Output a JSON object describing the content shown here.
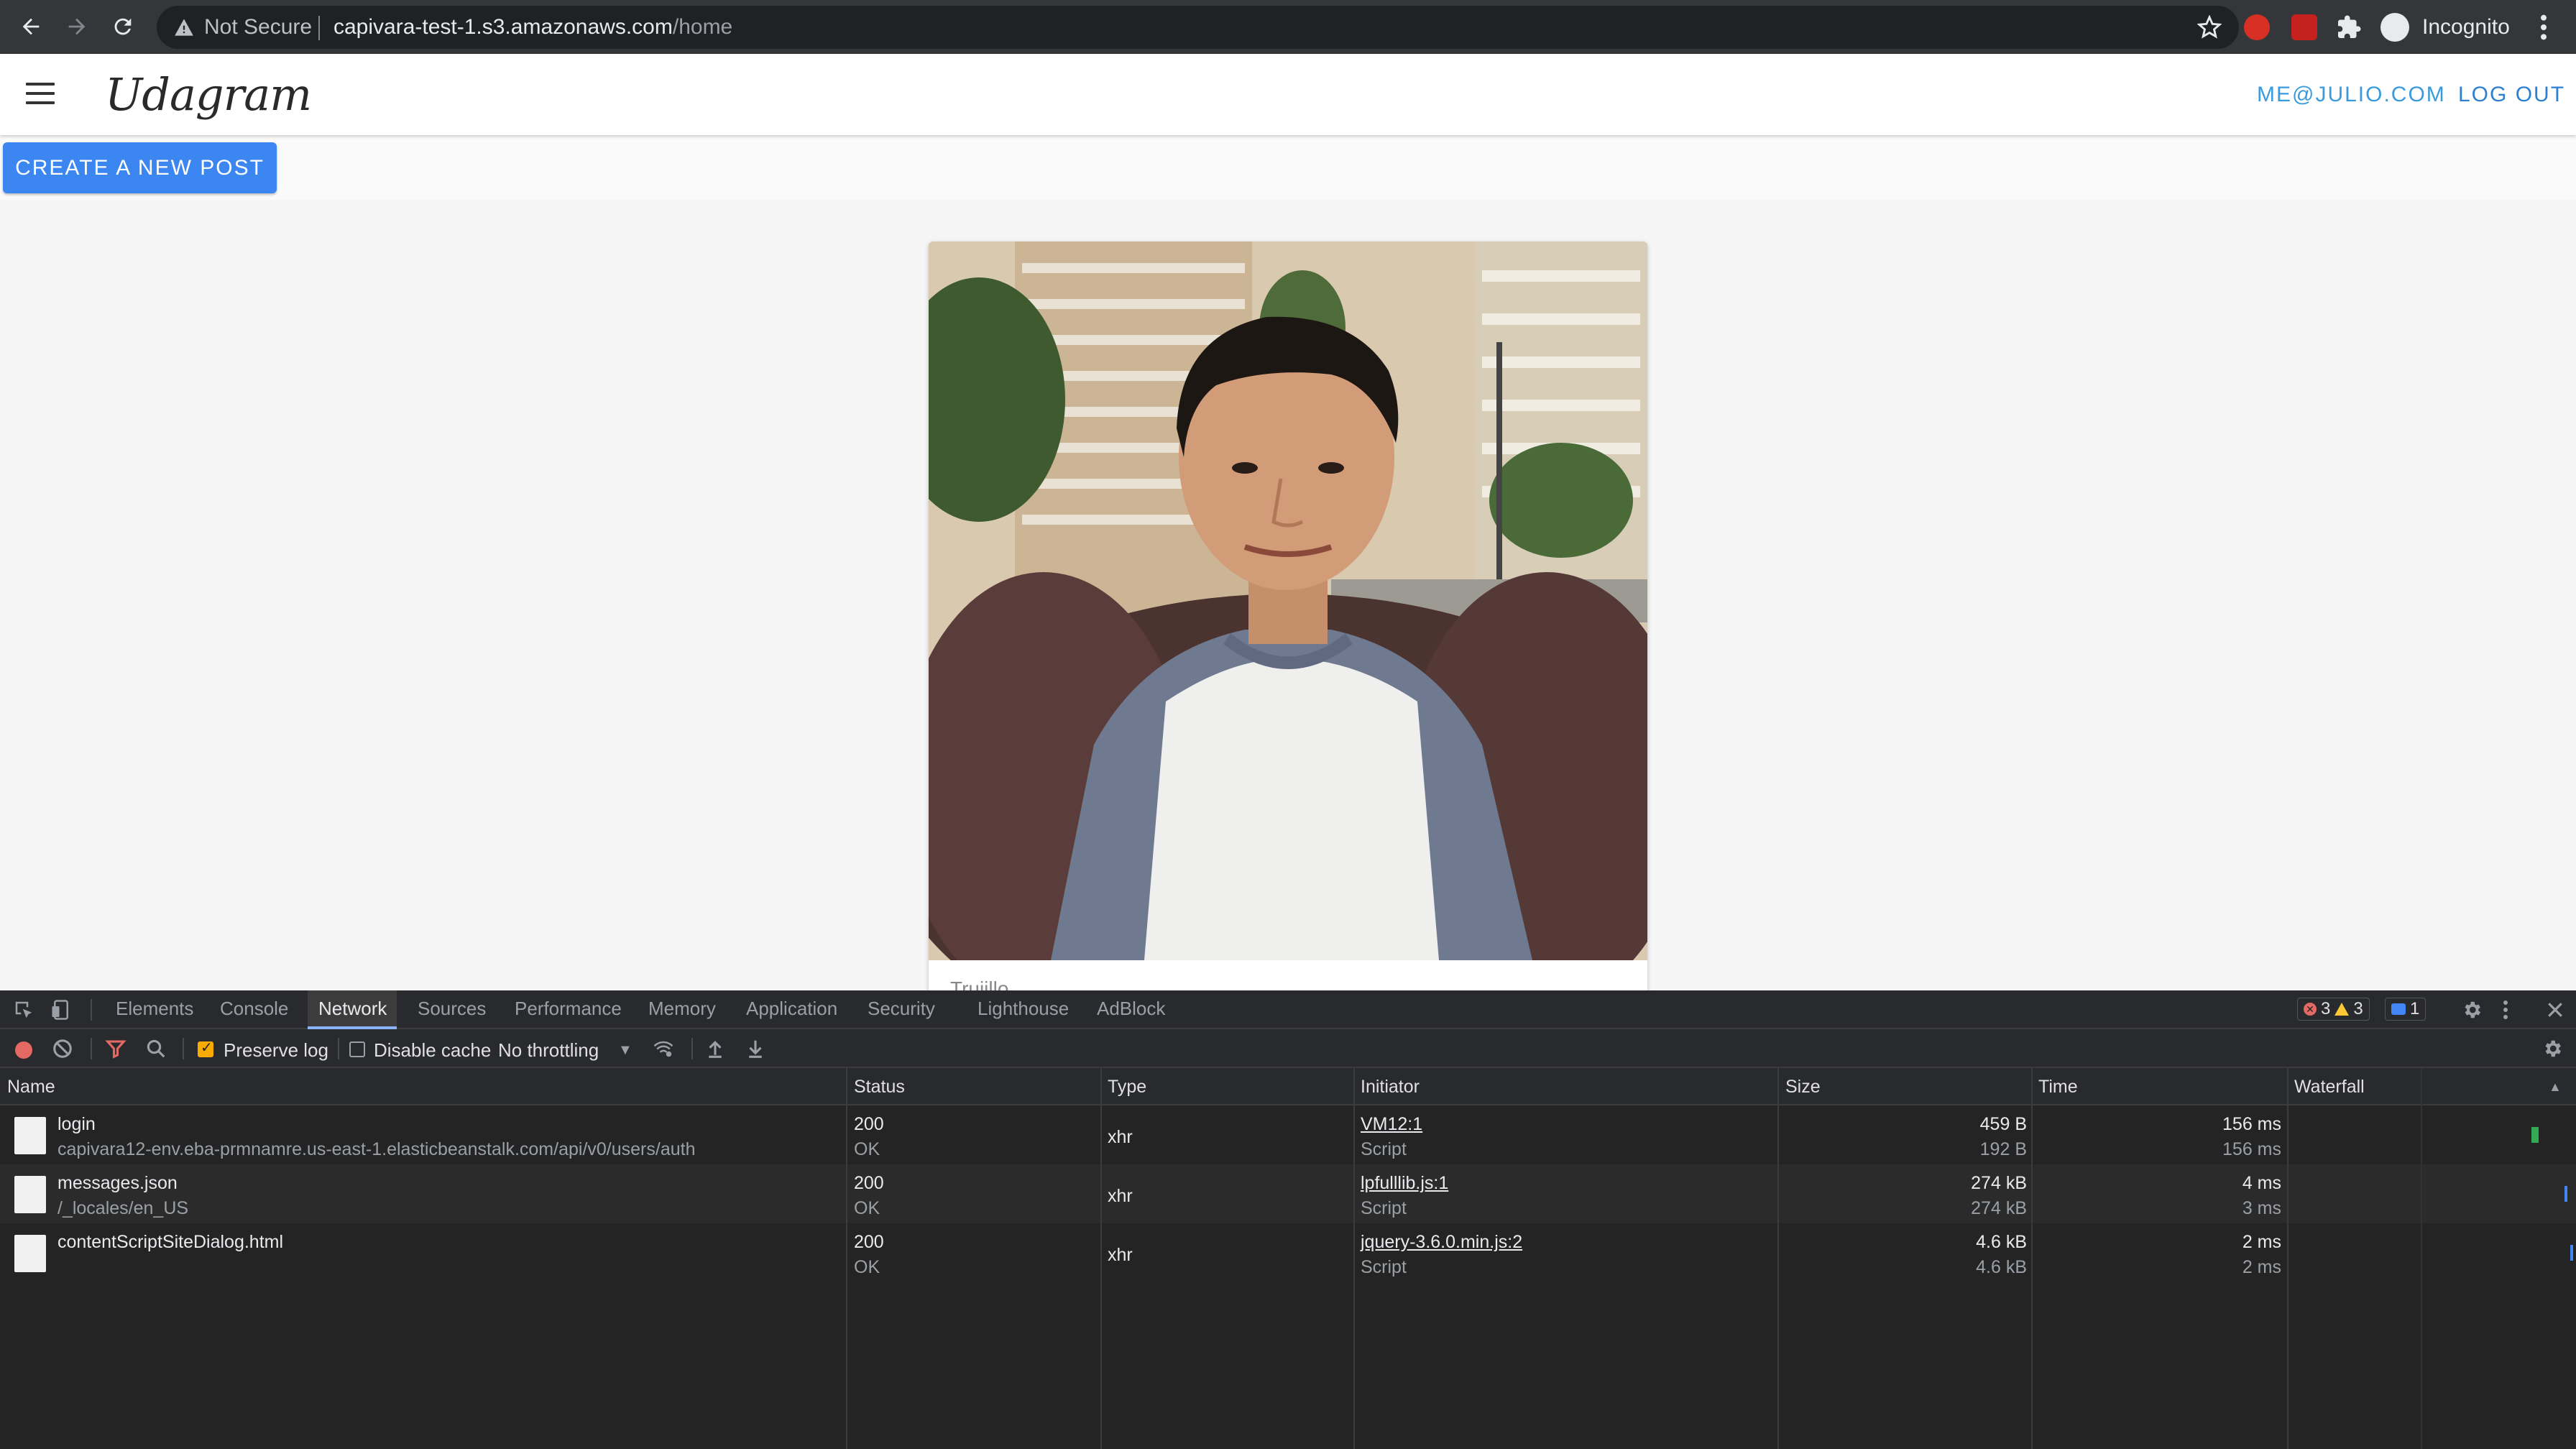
{
  "browser": {
    "security_label": "Not Secure",
    "url_host": "capivara-test-1.s3.amazonaws.com",
    "url_path": "/home",
    "profile_label": "Incognito"
  },
  "app": {
    "brand": "Udagram",
    "user_email": "ME@JULIO.COM",
    "logout_label": "LOG OUT",
    "create_post_label": "CREATE A NEW POST",
    "post": {
      "caption": "Trujillo"
    }
  },
  "devtools": {
    "tabs": [
      "Elements",
      "Console",
      "Network",
      "Sources",
      "Performance",
      "Memory",
      "Application",
      "Security",
      "Lighthouse",
      "AdBlock"
    ],
    "active_tab": "Network",
    "errors_count": "3",
    "warnings_count": "3",
    "messages_count": "1",
    "toolbar": {
      "preserve_log_label": "Preserve log",
      "disable_cache_label": "Disable cache",
      "throttling_label": "No throttling"
    },
    "columns": [
      "Name",
      "Status",
      "Type",
      "Initiator",
      "Size",
      "Time",
      "Waterfall"
    ],
    "rows": [
      {
        "name": "login",
        "path": "capivara12-env.eba-prmnamre.us-east-1.elasticbeanstalk.com/api/v0/users/auth",
        "status": "200",
        "status_text": "OK",
        "type": "xhr",
        "initiator": "VM12:1",
        "initiator_type": "Script",
        "size": "459 B",
        "resource_size": "192 B",
        "time": "156 ms",
        "latency": "156 ms"
      },
      {
        "name": "messages.json",
        "path": "/_locales/en_US",
        "status": "200",
        "status_text": "OK",
        "type": "xhr",
        "initiator": "lpfulllib.js:1",
        "initiator_type": "Script",
        "size": "274 kB",
        "resource_size": "274 kB",
        "time": "4 ms",
        "latency": "3 ms"
      },
      {
        "name": "contentScriptSiteDialog.html",
        "path": "",
        "status": "200",
        "status_text": "OK",
        "type": "xhr",
        "initiator": "jquery-3.6.0.min.js:2",
        "initiator_type": "Script",
        "size": "4.6 kB",
        "resource_size": "4.6 kB",
        "time": "2 ms",
        "latency": "2 ms"
      }
    ]
  },
  "colors": {
    "primary_button": "#3c86f2",
    "user_link": "#3a9bdc",
    "devtools_bg": "#242424"
  }
}
